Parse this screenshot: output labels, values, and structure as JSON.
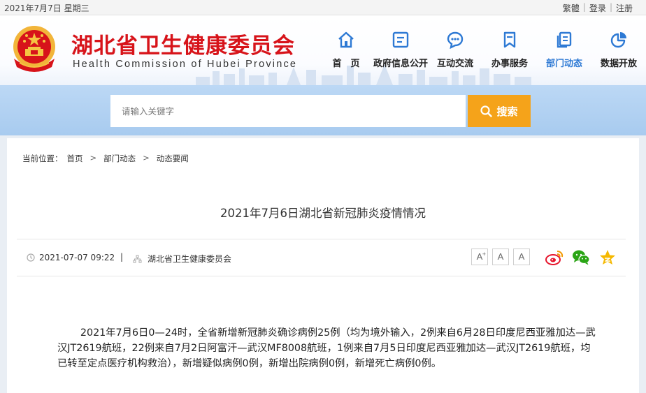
{
  "topbar": {
    "date": "2021年7月7日 星期三",
    "traditional": "繁體",
    "login": "登录",
    "register": "注册",
    "separator": "|"
  },
  "header": {
    "title": "湖北省卫生健康委员会",
    "subtitle": "HEALTH COMMISSION OF HUBEI PROVINCE",
    "subtitle_display": "Health Commission of Hubei Province"
  },
  "nav": [
    {
      "label": "首　页",
      "icon": "home-icon"
    },
    {
      "label": "政府信息公开",
      "icon": "document-icon"
    },
    {
      "label": "互动交流",
      "icon": "chat-icon"
    },
    {
      "label": "办事服务",
      "icon": "bookmark-icon"
    },
    {
      "label": "部门动态",
      "icon": "pages-icon",
      "active": true
    },
    {
      "label": "数据开放",
      "icon": "pie-chart-icon"
    }
  ],
  "search": {
    "placeholder": "请输入关键字",
    "button": "搜索"
  },
  "breadcrumb": {
    "label": "当前位置：",
    "items": [
      "首页",
      "部门动态",
      "动态要闻"
    ],
    "arrow": ">"
  },
  "article": {
    "title": "2021年7月6日湖北省新冠肺炎疫情情况",
    "time": "2021-07-07 09:22",
    "divider": "|",
    "source": "湖北省卫生健康委员会",
    "font_buttons": [
      "A",
      "A",
      "A"
    ],
    "body": "2021年7月6日0—24时，全省新增新冠肺炎确诊病例25例（均为境外输入，2例来自6月28日印度尼西亚雅加达—武汉JT2619航班，22例来自7月2日阿富汗—武汉MF8008航班，1例来自7月5日印度尼西亚雅加达—武汉JT2619航班，均已转至定点医疗机构救治），新增疑似病例0例，新增出院病例0例，新增死亡病例0例。"
  },
  "colors": {
    "brand_red": "#d7131a",
    "nav_active": "#2d79d4",
    "search_button": "#f5a31a",
    "banner": "#b3d2f2"
  }
}
